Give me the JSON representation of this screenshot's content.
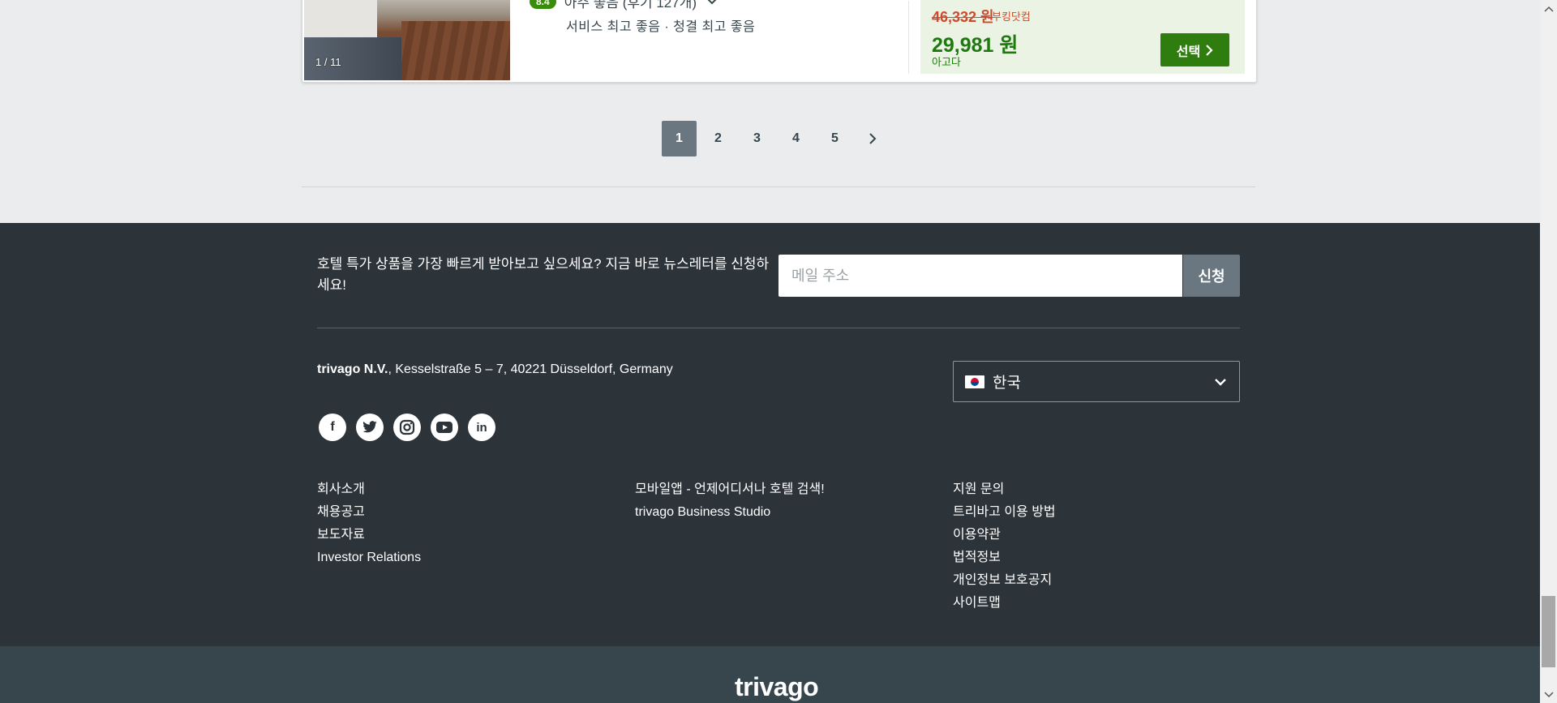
{
  "hotel_card": {
    "image_counter": "1 / 11",
    "rating_score": "8.4",
    "rating_text": "아주 좋음 (후기 127개)",
    "review_detail": "서비스 최고 좋음 · 청결 최고 좋음",
    "old_price": "46,332 원",
    "old_price_site": "부킹닷컴",
    "new_price": "29,981 원",
    "new_price_site": "아고다",
    "select_label": "선택"
  },
  "pagination": {
    "pages": [
      "1",
      "2",
      "3",
      "4",
      "5"
    ],
    "current": "1"
  },
  "footer": {
    "newsletter_text": "호텔 특가 상품을 가장 빠르게 받아보고 싶으세요? 지금 바로 뉴스레터를 신청하세요!",
    "email_placeholder": "메일 주소",
    "subscribe_label": "신청",
    "company_name": "trivago N.V.",
    "address": ", Kesselstraße 5 – 7, 40221 Düsseldorf, Germany",
    "language": "한국",
    "socials": [
      "facebook-icon",
      "twitter-icon",
      "instagram-icon",
      "youtube-icon",
      "linkedin-icon"
    ],
    "links_col1": [
      "회사소개",
      "채용공고",
      "보도자료",
      "Investor Relations"
    ],
    "links_col2": [
      "모바일앱 - 언제어디서나 호텔 검색!",
      "trivago Business Studio"
    ],
    "links_col3": [
      "지원 문의",
      "트리바고 이용 방법",
      "이용약관",
      "법적정보",
      "개인정보 보호공지",
      "사이트맵"
    ],
    "logo": "trivago"
  },
  "colors": {
    "footer_bg": "#2c3339",
    "select_button": "#2f7d0e",
    "rating_badge": "#3a8d0a",
    "old_price": "#cf4a2c",
    "new_price": "#1e7a0e"
  }
}
